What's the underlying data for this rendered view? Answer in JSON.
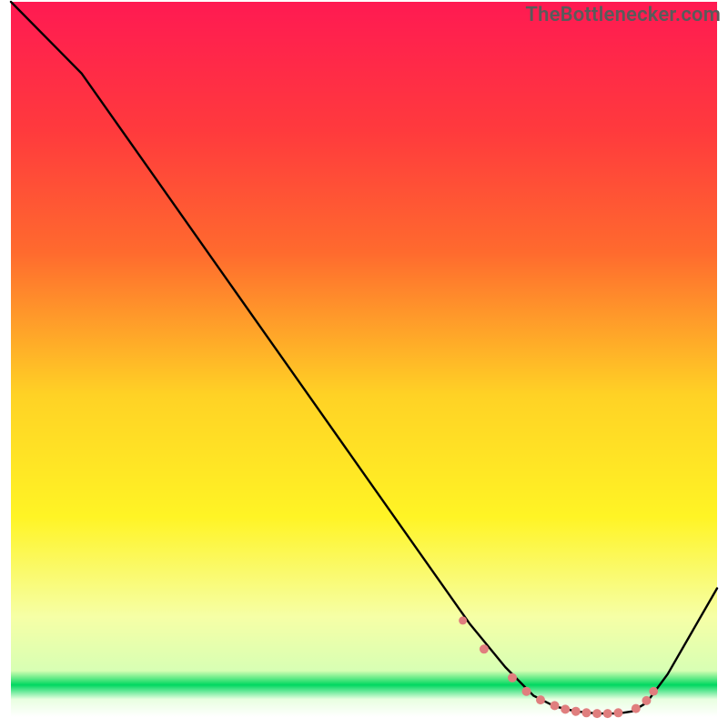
{
  "watermark": "TheBottlenecker.com",
  "colors": {
    "grad_top": "#ff1a52",
    "grad_upper": "#ff6a2e",
    "grad_mid_hi": "#ffd225",
    "grad_mid": "#fff425",
    "grad_lo": "#f6ffa6",
    "grad_narrow_green": "#00d860",
    "grad_bottom_white": "#ffffff",
    "curve": "#000000",
    "dots": "#e07e7e"
  },
  "chart_data": {
    "type": "line",
    "title": "",
    "xlabel": "",
    "ylabel": "",
    "xlim": [
      0,
      100
    ],
    "ylim": [
      0,
      100
    ],
    "series": [
      {
        "name": "curve",
        "x": [
          0,
          6,
          10,
          20,
          30,
          40,
          50,
          60,
          65,
          70,
          74,
          77,
          80,
          83,
          86,
          88,
          90,
          93,
          100
        ],
        "y": [
          100,
          94,
          90,
          76,
          62,
          48,
          34,
          20,
          13,
          7,
          3,
          1.5,
          0.8,
          0.5,
          0.5,
          0.8,
          2,
          6,
          18
        ]
      }
    ],
    "dots": {
      "name": "markers",
      "x": [
        64,
        67,
        71,
        73,
        75,
        77,
        78.5,
        80,
        81.5,
        83,
        84.5,
        86,
        88.5,
        90,
        91
      ],
      "y": [
        13.5,
        9.5,
        5.5,
        3.6,
        2.4,
        1.6,
        1.1,
        0.8,
        0.6,
        0.5,
        0.5,
        0.6,
        1.2,
        2.3,
        3.6
      ],
      "r": [
        4.5,
        5,
        5,
        5,
        5,
        5,
        5,
        5,
        5,
        5,
        5,
        5,
        5,
        5,
        4.8
      ]
    }
  }
}
